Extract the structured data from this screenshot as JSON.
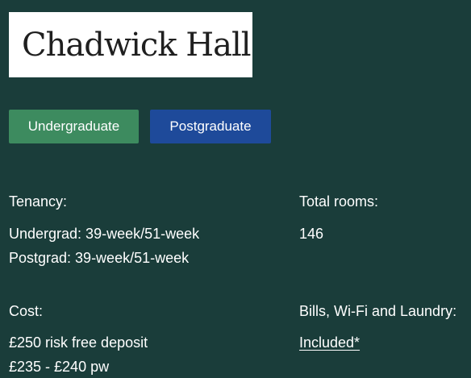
{
  "hall": {
    "name": "Chadwick Hall"
  },
  "tabs": {
    "undergraduate": "Undergraduate",
    "postgraduate": "Postgraduate"
  },
  "info": {
    "tenancy": {
      "label": "Tenancy:",
      "lines": [
        "Undergrad: 39-week/51-week",
        "Postgrad: 39-week/51-week"
      ]
    },
    "total_rooms": {
      "label": "Total rooms:",
      "value": "146"
    },
    "cost": {
      "label": "Cost:",
      "lines": [
        "£250 risk free deposit",
        "£235 - £240 pw"
      ]
    },
    "bills": {
      "label": "Bills, Wi-Fi and Laundry:",
      "value": "Included*"
    }
  },
  "colors": {
    "background": "#1a3d3a",
    "undergraduate_button": "#3d8b5f",
    "postgraduate_button": "#1e4a9a"
  }
}
